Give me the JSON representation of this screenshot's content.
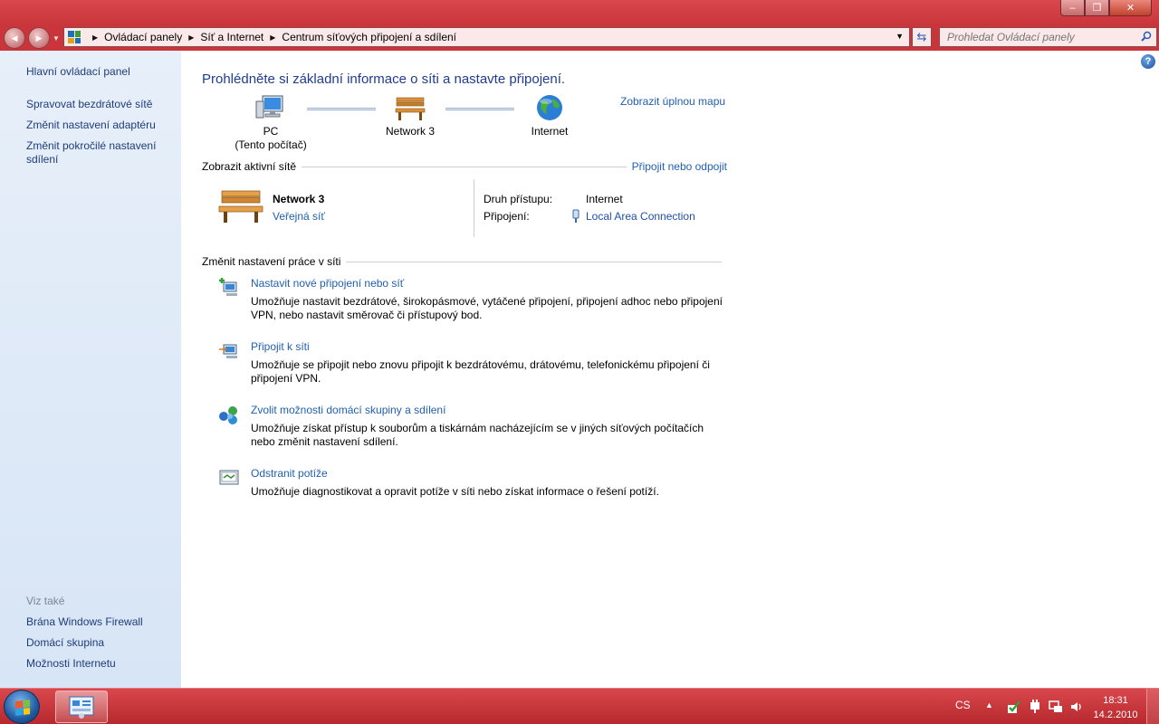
{
  "window": {
    "minimize": "–",
    "maximize": "❐",
    "close": "✕"
  },
  "address": {
    "back": "◀",
    "forward": "▶",
    "crumbs": [
      "Ovládací panely",
      "Síť a Internet",
      "Centrum síťových připojení a sdílení"
    ],
    "search_placeholder": "Prohledat Ovládací panely"
  },
  "sidebar": {
    "home": "Hlavní ovládací panel",
    "items": [
      "Spravovat bezdrátové sítě",
      "Změnit nastavení adaptéru",
      "Změnit pokročilé nastavení sdílení"
    ],
    "see_also_label": "Viz také",
    "see_also": [
      "Brána Windows Firewall",
      "Domácí skupina",
      "Možnosti Internetu"
    ]
  },
  "main": {
    "help": "?",
    "title": "Prohlédněte si základní informace o síti a nastavte připojení.",
    "full_map_link": "Zobrazit úplnou mapu",
    "map": {
      "pc_line1": "PC",
      "pc_line2": "(Tento počítač)",
      "network": "Network 3",
      "internet": "Internet"
    },
    "active_section": {
      "title": "Zobrazit aktivní sítě",
      "link": "Připojit nebo odpojit"
    },
    "active_network": {
      "name": "Network  3",
      "type": "Veřejná síť",
      "access_label": "Druh přístupu:",
      "access_value": "Internet",
      "connection_label": "Připojení:",
      "connection_value": "Local Area Connection"
    },
    "change_section": {
      "title": "Změnit nastavení práce v síti"
    },
    "tasks": [
      {
        "title": "Nastavit nové připojení nebo síť",
        "desc": "Umožňuje nastavit bezdrátové, širokopásmové, vytáčené připojení, připojení adhoc nebo připojení VPN, nebo nastavit směrovač či přístupový bod."
      },
      {
        "title": "Připojit k síti",
        "desc": "Umožňuje se připojit nebo znovu připojit k bezdrátovému, drátovému, telefonickému připojení či připojení VPN."
      },
      {
        "title": "Zvolit možnosti domácí skupiny a sdílení",
        "desc": "Umožňuje získat přístup k souborům a tiskárnám nacházejícím se v jiných síťových počítačích nebo změnit nastavení sdílení."
      },
      {
        "title": "Odstranit potíže",
        "desc": "Umožňuje diagnostikovat a opravit potíže v síti nebo získat informace o řešení potíží."
      }
    ]
  },
  "taskbar": {
    "language": "CS",
    "time": "18:31",
    "date": "14.2.2010"
  },
  "colors": {
    "frame": "#c9353a",
    "link": "#1f5fb0",
    "sidebar_bg": "#dfe9f7",
    "title_blue": "#1e3d8f"
  }
}
